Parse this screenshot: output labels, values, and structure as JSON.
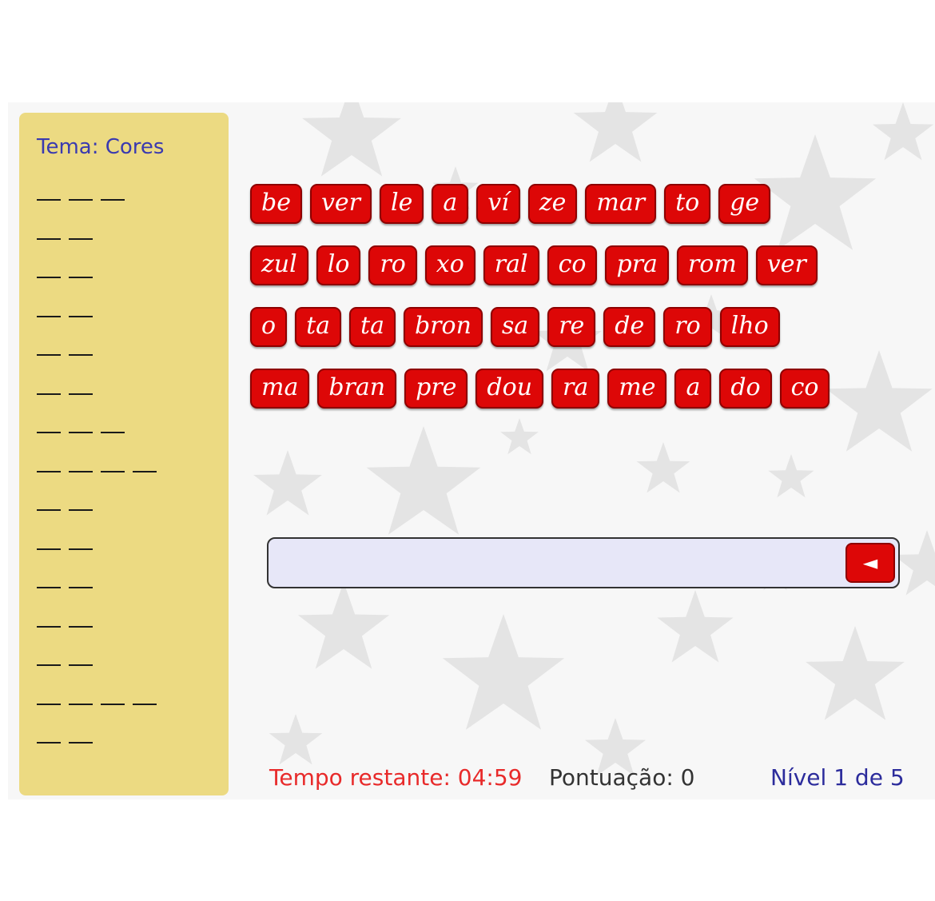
{
  "theme": "Tema: Cores",
  "word_slots": [
    {
      "syllables": 3
    },
    {
      "syllables": 2
    },
    {
      "syllables": 2
    },
    {
      "syllables": 2
    },
    {
      "syllables": 2
    },
    {
      "syllables": 2
    },
    {
      "syllables": 3
    },
    {
      "syllables": 4
    },
    {
      "syllables": 2
    },
    {
      "syllables": 2
    },
    {
      "syllables": 2
    },
    {
      "syllables": 2
    },
    {
      "syllables": 2
    },
    {
      "syllables": 4
    },
    {
      "syllables": 2
    }
  ],
  "syllable_rows": [
    [
      "be",
      "ver",
      "le",
      "a",
      "ví",
      "ze",
      "mar",
      "to",
      "ge"
    ],
    [
      "zul",
      "lo",
      "ro",
      "xo",
      "ral",
      "co",
      "pra",
      "rom",
      "ver"
    ],
    [
      "o",
      "ta",
      "ta",
      "bron",
      "sa",
      "re",
      "de",
      "ro",
      "lho"
    ],
    [
      "ma",
      "bran",
      "pre",
      "dou",
      "ra",
      "me",
      "a",
      "do",
      "co"
    ]
  ],
  "answer": {
    "value": "",
    "backspace_icon": "◄"
  },
  "status": {
    "timer": "Tempo restante: 04:59",
    "score": "Pontuação: 0",
    "level": "Nível 1 de 5"
  },
  "colors": {
    "tile": "#dd0707",
    "sidebar": "#ecda82",
    "theme_text": "#3a3ab0",
    "timer": "#e82a2a",
    "level": "#2c2c9c"
  }
}
